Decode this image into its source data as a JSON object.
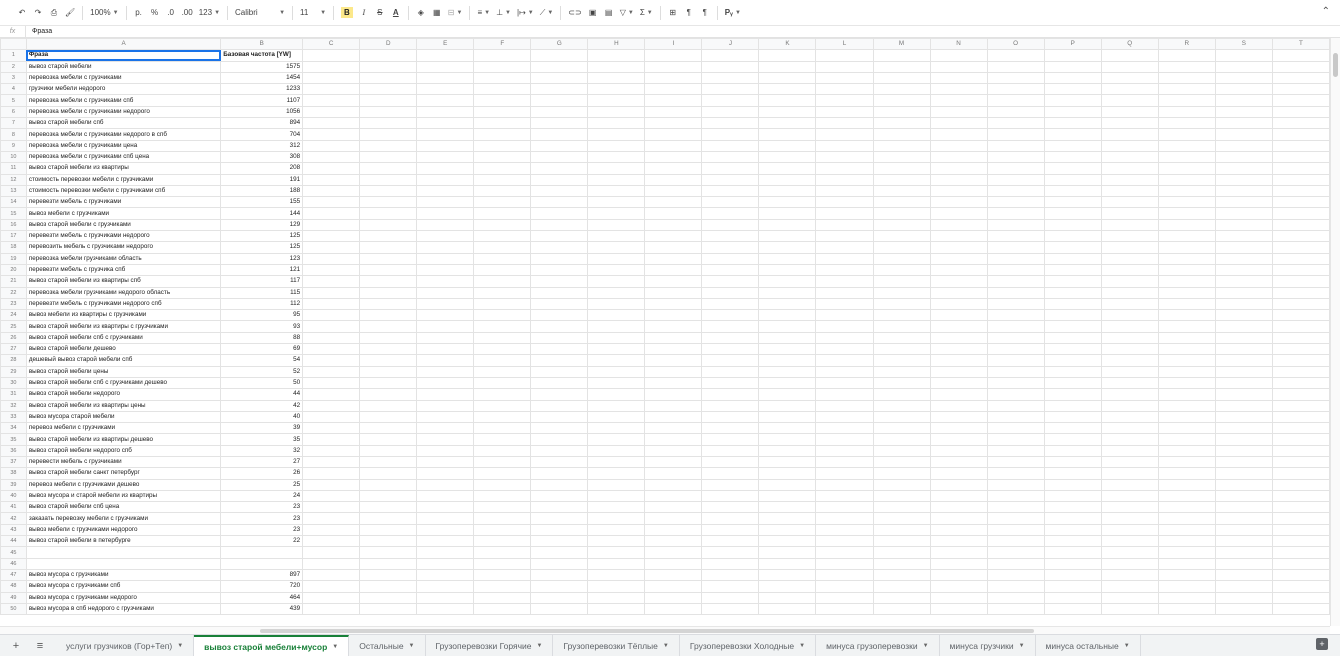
{
  "toolbar": {
    "zoom": "100%",
    "currency": "р.",
    "percent": "%",
    "dec_minus": ".0",
    "dec_plus": ".00",
    "format123": "123",
    "font": "Calibri",
    "size": "11",
    "bold": "B",
    "italic": "I",
    "strike": "S",
    "text_color": "A",
    "fx_label": "Рᵧ"
  },
  "formula_bar": {
    "fx": "fx",
    "value": "Фраза"
  },
  "columns": [
    "A",
    "B",
    "C",
    "D",
    "E",
    "F",
    "G",
    "H",
    "I",
    "J",
    "K",
    "L",
    "M",
    "N",
    "O",
    "P",
    "Q",
    "R",
    "S",
    "T"
  ],
  "rows": [
    [
      "Фраза",
      "Базовая частота [YW]"
    ],
    [
      "вывоз старой мебели",
      "1575"
    ],
    [
      "перевозка мебели с грузчиками",
      "1454"
    ],
    [
      "грузчики мебели недорого",
      "1233"
    ],
    [
      "перевозка мебели с грузчиками спб",
      "1107"
    ],
    [
      "перевозка мебели с грузчиками недорого",
      "1056"
    ],
    [
      "вывоз старой мебели спб",
      "894"
    ],
    [
      "перевозка мебели с грузчиками недорого в спб",
      "704"
    ],
    [
      "перевозка мебели с грузчиками цена",
      "312"
    ],
    [
      "перевозка мебели с грузчиками спб цена",
      "308"
    ],
    [
      "вывоз старой мебели из квартиры",
      "208"
    ],
    [
      "стоимость перевозки мебели с грузчиками",
      "191"
    ],
    [
      "стоимость перевозки мебели с грузчиками спб",
      "188"
    ],
    [
      "перевезти мебель с грузчиками",
      "155"
    ],
    [
      "вывоз мебели с грузчиками",
      "144"
    ],
    [
      "вывоз старой мебели с грузчиками",
      "129"
    ],
    [
      "перевезти мебель с грузчиками недорого",
      "125"
    ],
    [
      "перевозить мебель с грузчиками недорого",
      "125"
    ],
    [
      "перевозка мебели грузчиками область",
      "123"
    ],
    [
      "перевезти мебель с грузчика спб",
      "121"
    ],
    [
      "вывоз старой мебели из квартиры спб",
      "117"
    ],
    [
      "перевозка мебели грузчиками недорого область",
      "115"
    ],
    [
      "перевезти мебель с грузчиками недорого спб",
      "112"
    ],
    [
      "вывоз мебели из квартиры с грузчиками",
      "95"
    ],
    [
      "вывоз старой мебели из квартиры с грузчиками",
      "93"
    ],
    [
      "вывоз старой мебели спб с грузчиками",
      "88"
    ],
    [
      "вывоз старой мебели дешево",
      "69"
    ],
    [
      "дешевый вывоз старой мебели спб",
      "54"
    ],
    [
      "вывоз старой мебели цены",
      "52"
    ],
    [
      "вывоз старой мебели спб с грузчиками дешево",
      "50"
    ],
    [
      "вывоз старой мебели недорого",
      "44"
    ],
    [
      "вывоз старой мебели из квартиры цены",
      "42"
    ],
    [
      "вывоз мусора старой мебели",
      "40"
    ],
    [
      "перевоз мебели с грузчиками",
      "39"
    ],
    [
      "вывоз старой мебели из квартиры дешево",
      "35"
    ],
    [
      "вывоз старой мебели недорого спб",
      "32"
    ],
    [
      "перевести мебель с грузчиками",
      "27"
    ],
    [
      "вывоз старой мебели санкт петербург",
      "26"
    ],
    [
      "перевоз мебели с грузчиками дешево",
      "25"
    ],
    [
      "вывоз мусора и старой мебели из квартиры",
      "24"
    ],
    [
      "вывоз старой мебели спб цена",
      "23"
    ],
    [
      "заказать перевозку мебели с грузчиками",
      "23"
    ],
    [
      "вывоз мебели с грузчиками недорого",
      "23"
    ],
    [
      "вывоз старой мебели в петербурге",
      "22"
    ],
    [
      "",
      ""
    ],
    [
      "",
      ""
    ],
    [
      "вывоз мусора с грузчиками",
      "897"
    ],
    [
      "вывоз мусора с грузчиками спб",
      "720"
    ],
    [
      "вывоз мусора с грузчиками недорого",
      "464"
    ],
    [
      "вывоз мусора в спб недорого с грузчиками",
      "439"
    ]
  ],
  "sheet_tabs": [
    {
      "label": "услуги грузчиков (Гор+Теп)",
      "active": false
    },
    {
      "label": "вывоз старой мебели+мусор",
      "active": true
    },
    {
      "label": "Остальные",
      "active": false
    },
    {
      "label": "Грузоперевозки Горячие",
      "active": false
    },
    {
      "label": "Грузоперевозки Тёплые",
      "active": false
    },
    {
      "label": "Грузоперевозки Холодные",
      "active": false
    },
    {
      "label": "минуса грузоперевозки",
      "active": false
    },
    {
      "label": "минуса грузчики",
      "active": false
    },
    {
      "label": "минуса остальные",
      "active": false
    }
  ],
  "colors": {
    "accent": "#1a73e8",
    "active_tab": "#188038",
    "bold_highlight": "#fce88a"
  }
}
